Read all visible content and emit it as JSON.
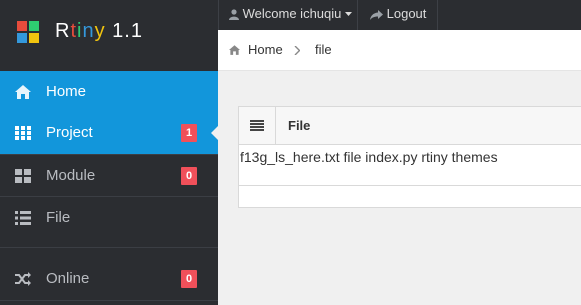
{
  "app": {
    "brand_letters": [
      "R",
      "t",
      "i",
      "n",
      "y"
    ],
    "version": "1.1"
  },
  "colors": {
    "logo": [
      "#e74c3c",
      "#2ecc71",
      "#3498db",
      "#f1c40f"
    ],
    "brand_letters": [
      "#ffffff",
      "#e74c3c",
      "#2ecc71",
      "#3498db",
      "#f1c40f"
    ],
    "active": "#1296db",
    "badge": "#f0505a"
  },
  "topbar": {
    "welcome": "Welcome ichuqiu",
    "logout": "Logout"
  },
  "sidebar": {
    "items": [
      {
        "label": "Home",
        "icon": "home-icon",
        "active": true
      },
      {
        "label": "Project",
        "icon": "grid-icon",
        "active": true,
        "badge": "1"
      },
      {
        "label": "Module",
        "icon": "blocks-icon",
        "badge": "0"
      },
      {
        "label": "File",
        "icon": "list-icon"
      },
      {
        "label": "Online",
        "icon": "shuffle-icon",
        "badge": "0"
      }
    ]
  },
  "breadcrumb": {
    "home": "Home",
    "current": "file"
  },
  "file_panel": {
    "header": "File",
    "content": "f13g_ls_here.txt file index.py rtiny themes"
  }
}
